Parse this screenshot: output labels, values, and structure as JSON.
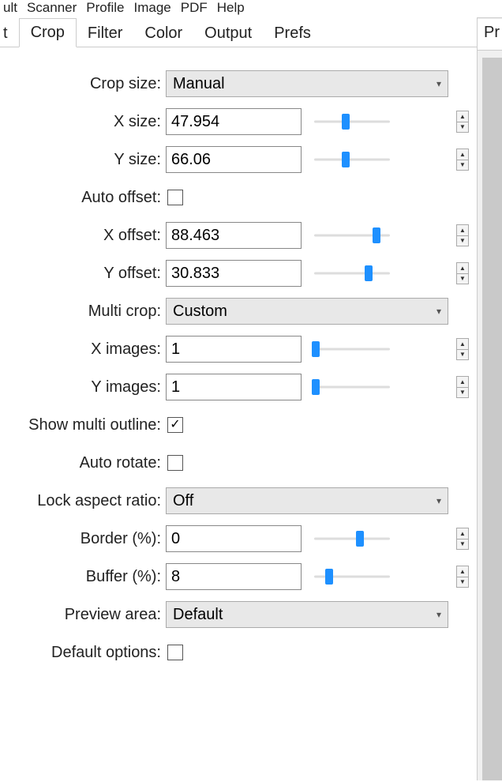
{
  "menubar": {
    "items": [
      "ult",
      "Scanner",
      "Profile",
      "Image",
      "PDF",
      "Help"
    ]
  },
  "tabs": {
    "items": [
      {
        "label": "t"
      },
      {
        "label": "Crop"
      },
      {
        "label": "Filter"
      },
      {
        "label": "Color"
      },
      {
        "label": "Output"
      },
      {
        "label": "Prefs"
      }
    ],
    "active_index": 1
  },
  "right_tab": {
    "label": "Pr"
  },
  "form": {
    "crop_size": {
      "label": "Crop size:",
      "value": "Manual"
    },
    "x_size": {
      "label": "X size:",
      "value": "47.954",
      "slider_pct": 42
    },
    "y_size": {
      "label": "Y size:",
      "value": "66.06",
      "slider_pct": 42
    },
    "auto_offset": {
      "label": "Auto offset:",
      "checked": false
    },
    "x_offset": {
      "label": "X offset:",
      "value": "88.463",
      "slider_pct": 82
    },
    "y_offset": {
      "label": "Y offset:",
      "value": "30.833",
      "slider_pct": 72
    },
    "multi_crop": {
      "label": "Multi crop:",
      "value": "Custom"
    },
    "x_images": {
      "label": "X images:",
      "value": "1",
      "slider_pct": 2
    },
    "y_images": {
      "label": "Y images:",
      "value": "1",
      "slider_pct": 2
    },
    "show_outline": {
      "label": "Show multi outline:",
      "checked": true
    },
    "auto_rotate": {
      "label": "Auto rotate:",
      "checked": false
    },
    "lock_aspect": {
      "label": "Lock aspect ratio:",
      "value": "Off"
    },
    "border": {
      "label": "Border (%):",
      "value": "0",
      "slider_pct": 60
    },
    "buffer": {
      "label": "Buffer (%):",
      "value": "8",
      "slider_pct": 20
    },
    "preview": {
      "label": "Preview area:",
      "value": "Default"
    },
    "default_opts": {
      "label": "Default options:",
      "checked": false
    }
  }
}
